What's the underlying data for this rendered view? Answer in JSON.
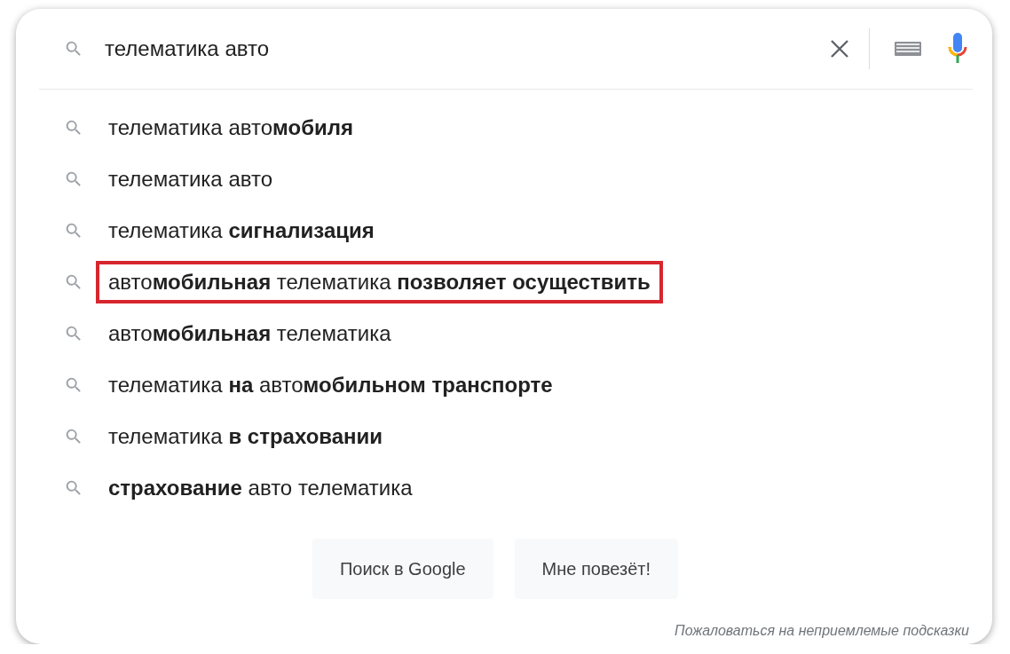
{
  "search": {
    "value": "телематика авто"
  },
  "suggestions": [
    {
      "text": "телематика авто**мобиля**",
      "highlighted": false
    },
    {
      "text": "телематика авто",
      "highlighted": false
    },
    {
      "text": "телематика **сигнализация**",
      "highlighted": false
    },
    {
      "text": "авто**мобильная** телематика **позволяет осуществить**",
      "highlighted": true
    },
    {
      "text": "авто**мобильная** телематика",
      "highlighted": false
    },
    {
      "text": "телематика **на** авто**мобильном транспорте**",
      "highlighted": false
    },
    {
      "text": "телематика **в страховании**",
      "highlighted": false
    },
    {
      "text": "**страхование** авто телематика",
      "highlighted": false
    }
  ],
  "buttons": [
    "Поиск в Google",
    "Мне повезёт!"
  ],
  "report_link": "Пожаловаться на неприемлемые подсказки"
}
